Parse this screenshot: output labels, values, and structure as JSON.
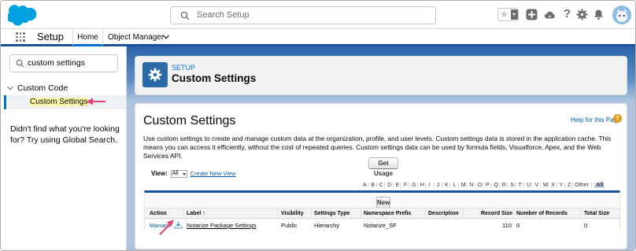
{
  "header": {
    "search_placeholder": "Search Setup"
  },
  "nav": {
    "app_name": "Setup",
    "tabs": [
      {
        "label": "Home"
      },
      {
        "label": "Object Manager"
      }
    ]
  },
  "sidebar": {
    "quickfind_value": "custom settings",
    "tree_parent": "Custom Code",
    "tree_child": "Custom Settings",
    "not_found_text": "Didn't find what you're looking for? Try using Global Search."
  },
  "setup_header": {
    "eyebrow": "SETUP",
    "title": "Custom Settings"
  },
  "main": {
    "title": "Custom Settings",
    "help_link": "Help for this Page",
    "description": "Use custom settings to create and manage custom data at the organization, profile, and user levels. Custom settings data is stored in the application cache. This means you can access it efficiently, without the cost of repeated queries. Custom settings data can be used by formula fields, Visualforce, Apex, and the Web Services API.",
    "get_usage_label": "Get Usage",
    "view_label": "View:",
    "view_value": "All",
    "create_view_label": "Create New View",
    "alphabet": [
      "A",
      "B",
      "C",
      "D",
      "E",
      "F",
      "G",
      "H",
      "I",
      "J",
      "K",
      "L",
      "M",
      "N",
      "O",
      "P",
      "Q",
      "R",
      "S",
      "T",
      "U",
      "V",
      "W",
      "X",
      "Y",
      "Z",
      "Other",
      "All"
    ],
    "new_label": "New",
    "columns": {
      "action": "Action",
      "label": "Label ↑",
      "visibility": "Visibility",
      "settings_type": "Settings Type",
      "namespace": "Namespace Prefix",
      "description": "Description",
      "record_size": "Record Size",
      "num_records": "Number of Records",
      "total_size": "Total Size"
    },
    "row": {
      "action": "Manage",
      "label": "Notarize Package Settings",
      "visibility": "Public",
      "settings_type": "Hierarchy",
      "namespace": "Notarize_SF",
      "description": "",
      "record_size": "110",
      "num_records": "0",
      "total_size": "0"
    }
  },
  "colors": {
    "brand_blue": "#1b5297",
    "link_blue": "#015ba7",
    "highlight_yellow": "#fdf9a8",
    "annotation_pink": "#e8406c"
  }
}
